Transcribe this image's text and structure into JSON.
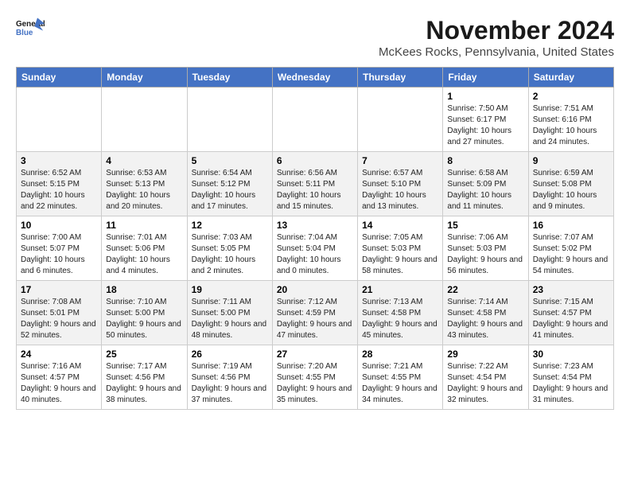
{
  "header": {
    "logo_line1": "General",
    "logo_line2": "Blue",
    "month": "November 2024",
    "location": "McKees Rocks, Pennsylvania, United States"
  },
  "days_of_week": [
    "Sunday",
    "Monday",
    "Tuesday",
    "Wednesday",
    "Thursday",
    "Friday",
    "Saturday"
  ],
  "weeks": [
    [
      {
        "day": "",
        "info": ""
      },
      {
        "day": "",
        "info": ""
      },
      {
        "day": "",
        "info": ""
      },
      {
        "day": "",
        "info": ""
      },
      {
        "day": "",
        "info": ""
      },
      {
        "day": "1",
        "info": "Sunrise: 7:50 AM\nSunset: 6:17 PM\nDaylight: 10 hours and 27 minutes."
      },
      {
        "day": "2",
        "info": "Sunrise: 7:51 AM\nSunset: 6:16 PM\nDaylight: 10 hours and 24 minutes."
      }
    ],
    [
      {
        "day": "3",
        "info": "Sunrise: 6:52 AM\nSunset: 5:15 PM\nDaylight: 10 hours and 22 minutes."
      },
      {
        "day": "4",
        "info": "Sunrise: 6:53 AM\nSunset: 5:13 PM\nDaylight: 10 hours and 20 minutes."
      },
      {
        "day": "5",
        "info": "Sunrise: 6:54 AM\nSunset: 5:12 PM\nDaylight: 10 hours and 17 minutes."
      },
      {
        "day": "6",
        "info": "Sunrise: 6:56 AM\nSunset: 5:11 PM\nDaylight: 10 hours and 15 minutes."
      },
      {
        "day": "7",
        "info": "Sunrise: 6:57 AM\nSunset: 5:10 PM\nDaylight: 10 hours and 13 minutes."
      },
      {
        "day": "8",
        "info": "Sunrise: 6:58 AM\nSunset: 5:09 PM\nDaylight: 10 hours and 11 minutes."
      },
      {
        "day": "9",
        "info": "Sunrise: 6:59 AM\nSunset: 5:08 PM\nDaylight: 10 hours and 9 minutes."
      }
    ],
    [
      {
        "day": "10",
        "info": "Sunrise: 7:00 AM\nSunset: 5:07 PM\nDaylight: 10 hours and 6 minutes."
      },
      {
        "day": "11",
        "info": "Sunrise: 7:01 AM\nSunset: 5:06 PM\nDaylight: 10 hours and 4 minutes."
      },
      {
        "day": "12",
        "info": "Sunrise: 7:03 AM\nSunset: 5:05 PM\nDaylight: 10 hours and 2 minutes."
      },
      {
        "day": "13",
        "info": "Sunrise: 7:04 AM\nSunset: 5:04 PM\nDaylight: 10 hours and 0 minutes."
      },
      {
        "day": "14",
        "info": "Sunrise: 7:05 AM\nSunset: 5:03 PM\nDaylight: 9 hours and 58 minutes."
      },
      {
        "day": "15",
        "info": "Sunrise: 7:06 AM\nSunset: 5:03 PM\nDaylight: 9 hours and 56 minutes."
      },
      {
        "day": "16",
        "info": "Sunrise: 7:07 AM\nSunset: 5:02 PM\nDaylight: 9 hours and 54 minutes."
      }
    ],
    [
      {
        "day": "17",
        "info": "Sunrise: 7:08 AM\nSunset: 5:01 PM\nDaylight: 9 hours and 52 minutes."
      },
      {
        "day": "18",
        "info": "Sunrise: 7:10 AM\nSunset: 5:00 PM\nDaylight: 9 hours and 50 minutes."
      },
      {
        "day": "19",
        "info": "Sunrise: 7:11 AM\nSunset: 5:00 PM\nDaylight: 9 hours and 48 minutes."
      },
      {
        "day": "20",
        "info": "Sunrise: 7:12 AM\nSunset: 4:59 PM\nDaylight: 9 hours and 47 minutes."
      },
      {
        "day": "21",
        "info": "Sunrise: 7:13 AM\nSunset: 4:58 PM\nDaylight: 9 hours and 45 minutes."
      },
      {
        "day": "22",
        "info": "Sunrise: 7:14 AM\nSunset: 4:58 PM\nDaylight: 9 hours and 43 minutes."
      },
      {
        "day": "23",
        "info": "Sunrise: 7:15 AM\nSunset: 4:57 PM\nDaylight: 9 hours and 41 minutes."
      }
    ],
    [
      {
        "day": "24",
        "info": "Sunrise: 7:16 AM\nSunset: 4:57 PM\nDaylight: 9 hours and 40 minutes."
      },
      {
        "day": "25",
        "info": "Sunrise: 7:17 AM\nSunset: 4:56 PM\nDaylight: 9 hours and 38 minutes."
      },
      {
        "day": "26",
        "info": "Sunrise: 7:19 AM\nSunset: 4:56 PM\nDaylight: 9 hours and 37 minutes."
      },
      {
        "day": "27",
        "info": "Sunrise: 7:20 AM\nSunset: 4:55 PM\nDaylight: 9 hours and 35 minutes."
      },
      {
        "day": "28",
        "info": "Sunrise: 7:21 AM\nSunset: 4:55 PM\nDaylight: 9 hours and 34 minutes."
      },
      {
        "day": "29",
        "info": "Sunrise: 7:22 AM\nSunset: 4:54 PM\nDaylight: 9 hours and 32 minutes."
      },
      {
        "day": "30",
        "info": "Sunrise: 7:23 AM\nSunset: 4:54 PM\nDaylight: 9 hours and 31 minutes."
      }
    ]
  ]
}
